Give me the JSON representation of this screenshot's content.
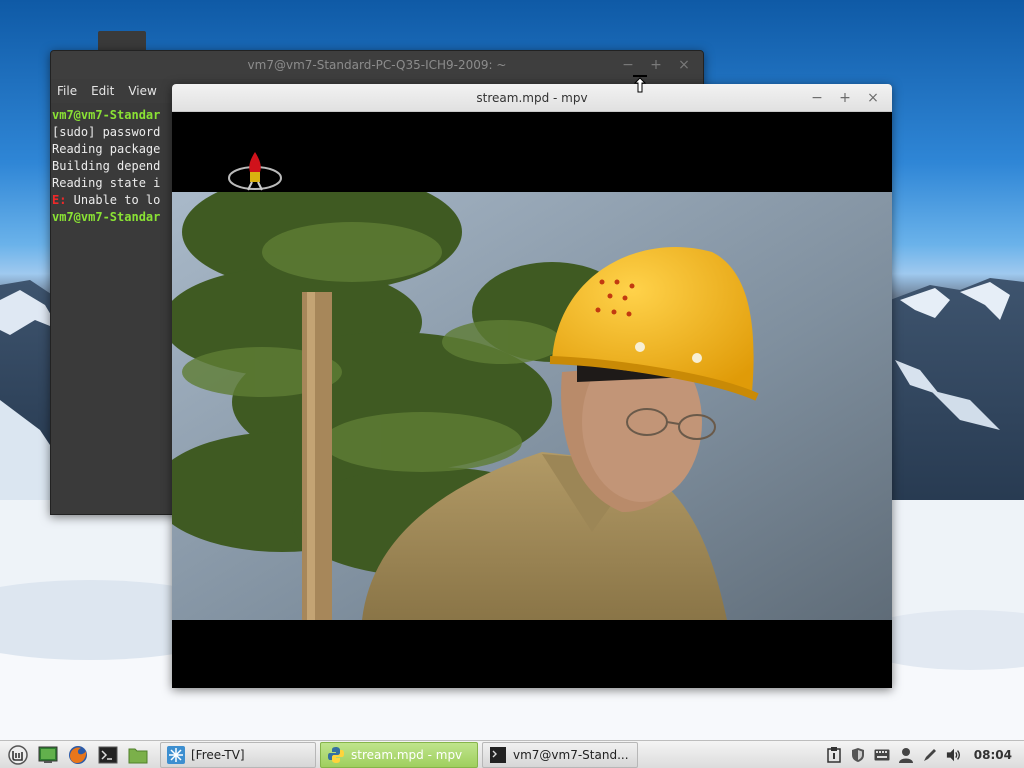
{
  "desktop": {
    "colors": {
      "sky": "#2f86d6",
      "snow": "#f1f5fa"
    }
  },
  "terminal": {
    "title": "vm7@vm7-Standard-PC-Q35-ICH9-2009: ~",
    "menu": [
      "File",
      "Edit",
      "View"
    ],
    "lines": [
      {
        "text": "vm7@vm7-Standar",
        "style": "green"
      },
      {
        "text": "[sudo] password",
        "style": "normal"
      },
      {
        "text": "Reading package",
        "style": "normal"
      },
      {
        "text": "Building depend",
        "style": "normal"
      },
      {
        "text": "Reading state i",
        "style": "normal"
      },
      {
        "prefix": "E:",
        "text": " Unable to lo",
        "style": "error"
      },
      {
        "text": "vm7@vm7-Standar",
        "style": "green"
      }
    ]
  },
  "mpv": {
    "title": "stream.mpd - mpv",
    "video": {
      "description_colors": {
        "helmet": "#f2a90f",
        "shirt": "#a08a5a"
      }
    }
  },
  "window_controls": {
    "minimize": "−",
    "maximize": "+",
    "close": "×"
  },
  "taskbar": {
    "launchers": [
      {
        "name": "mint-menu-icon",
        "color": "#6aa84f"
      },
      {
        "name": "show-desktop-icon",
        "color": "#4f8f2f"
      },
      {
        "name": "firefox-icon",
        "color": "#e07a1c"
      },
      {
        "name": "terminal-icon",
        "color": "#222222"
      },
      {
        "name": "files-icon",
        "color": "#7bb04a"
      }
    ],
    "tasks": [
      {
        "label": "[Free-TV]",
        "icon": "snowflake-icon",
        "active": false
      },
      {
        "label": "stream.mpd - mpv",
        "icon": "python-icon",
        "active": true
      },
      {
        "label": "vm7@vm7-Stand...",
        "icon": "terminal-icon",
        "active": false
      }
    ],
    "tray": [
      "clipboard-icon",
      "shield-icon",
      "keyboard-icon",
      "user-icon",
      "pen-icon",
      "volume-icon"
    ],
    "clock": "08:04"
  }
}
